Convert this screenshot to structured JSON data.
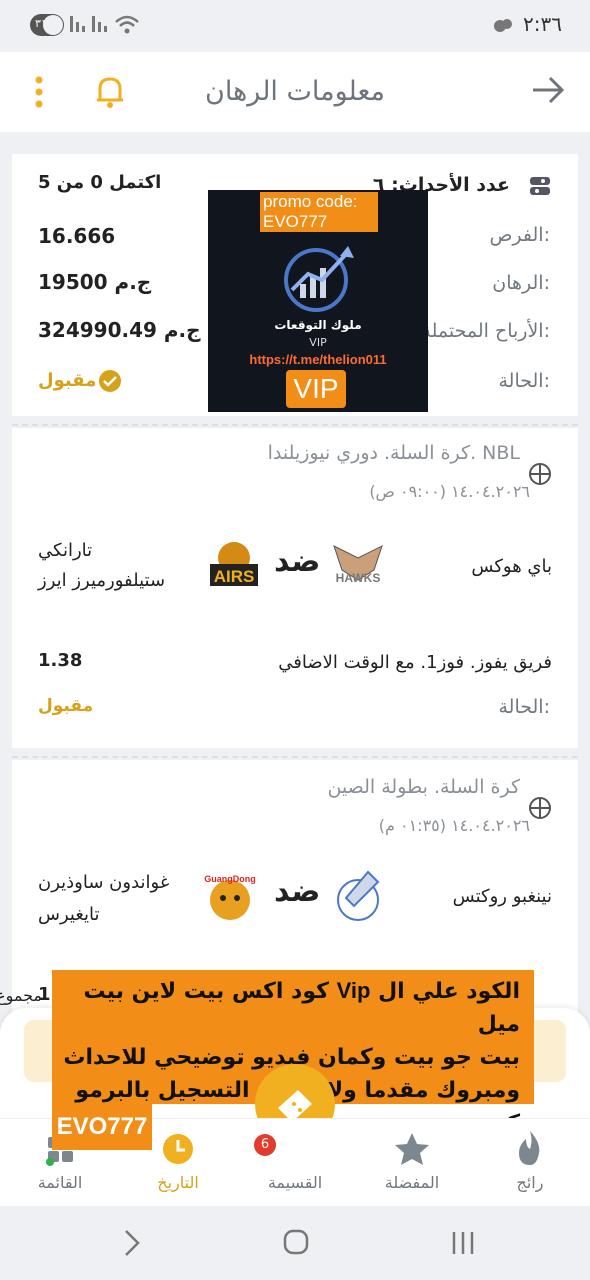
{
  "status_bar": {
    "time": "٢:٣٦",
    "battery": "٣١",
    "icons": [
      "weather-icon",
      "wifi-icon",
      "signal-icon",
      "battery-icon"
    ]
  },
  "header": {
    "title": "معلومات الرهان",
    "icons": [
      "back-arrow-icon",
      "bell-icon",
      "more-vertical-icon"
    ]
  },
  "summary": {
    "events_label": "عدد الأحداث: ٦",
    "completed_text": "اكتمل 0 من 5",
    "odds_label": "الفرص:",
    "odds_value": "16.666",
    "stake_label": "الرهان:",
    "stake_value": "19500 ج.م",
    "potential_label": "الأرباح المحتملة:",
    "potential_value": "324990.49 ج.م",
    "status_label": "الحالة:",
    "status_value": "مقبول"
  },
  "promo_overlay": {
    "code_line1": "promo code:",
    "code_line2": "EVO777",
    "channel_name": "ملوك التوقعات",
    "vip_small": "VIP",
    "link": "https://t.me/thelion011",
    "vip_badge": "VIP"
  },
  "events": [
    {
      "sport_league": "كرة السلة. دوري نيوزيلندا. NBL",
      "datetime": "١٤.٠٤.٢٠٢٦ (٠٩:٠٠ ص)",
      "home_team": "باي هوكس",
      "home_logo_text": "HAWKS",
      "vs": "ضد",
      "away_team_line1": "تارانكي",
      "away_team_line2": "ستيلفورميرز ايرز",
      "away_logo_text": "AIRS",
      "bet_text": "فريق يفوز. فوز1. مع الوقت الاضافي",
      "bet_odds": "1.38",
      "status_label": "الحالة:",
      "status_value": "مقبول"
    },
    {
      "sport_league": "كرة السلة. بطولة الصين",
      "datetime": "١٤.٠٤.٢٠٢٦ (٠١:٣٥ م)",
      "home_team": "نينغبو روكتس",
      "vs": "ضد",
      "away_team_line1": "غواندون ساوذيرن",
      "away_team_line2": "تايغيرس",
      "away_logo_text": "GuangDong",
      "bet_text_partial": "مجموع",
      "bet_odds_partial": "1."
    }
  ],
  "banner": {
    "line1_a": "الكود علي ال",
    "line1_vip": "Vip",
    "line1_b": "كود اكس بيت لاين بيت ميل",
    "line2": "بيت جو بيت وكمان فيديو توضيحي للاحداث",
    "line3": "ومبروك مقدما ولا تنسي التسجيل بالبرمو كود",
    "code": "EVO777"
  },
  "bottom_nav": {
    "items": [
      {
        "label": "رائج",
        "icon": "flame-icon"
      },
      {
        "label": "المفضلة",
        "icon": "star-icon"
      },
      {
        "label": "القسيمة",
        "icon": "ticket-icon",
        "badge": "6"
      },
      {
        "label": "التاريخ",
        "icon": "clock-icon",
        "active": true
      },
      {
        "label": "القائمة",
        "icon": "menu-grid-icon"
      }
    ]
  },
  "colors": {
    "accent": "#f1b020",
    "accepted": "#d6a21a",
    "promo_orange": "#f28e17",
    "badge_red": "#e33c2c"
  }
}
